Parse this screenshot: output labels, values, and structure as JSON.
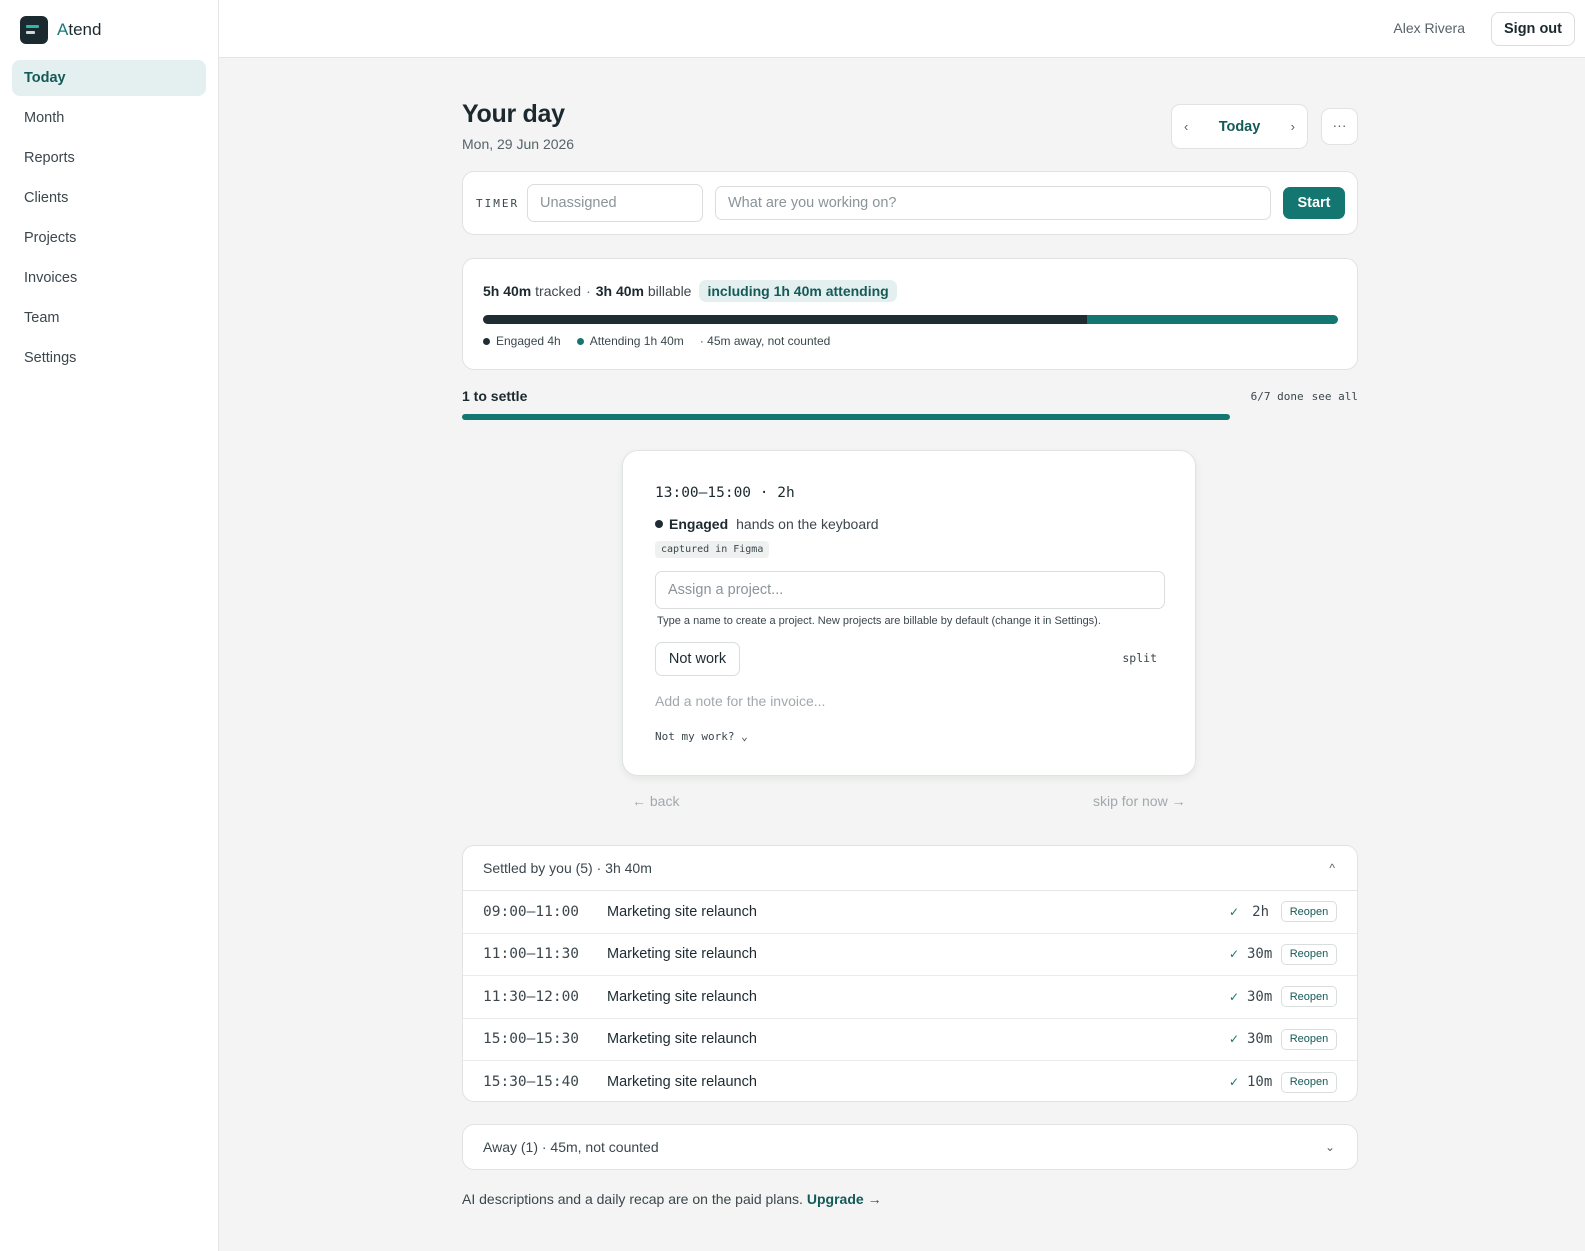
{
  "app": {
    "brand_prefix": "A",
    "brand_rest": "tend"
  },
  "nav": {
    "items": [
      {
        "label": "Today",
        "active": true
      },
      {
        "label": "Month"
      },
      {
        "label": "Reports"
      },
      {
        "label": "Clients"
      },
      {
        "label": "Projects"
      },
      {
        "label": "Invoices"
      },
      {
        "label": "Team"
      },
      {
        "label": "Settings"
      }
    ]
  },
  "topbar": {
    "user_name": "Alex Rivera",
    "signout_label": "Sign out"
  },
  "header": {
    "title": "Your day",
    "date": "Mon, 29 Jun 2026",
    "prev_glyph": "‹",
    "today_label": "Today",
    "next_glyph": "›",
    "more_glyph": "···"
  },
  "timer": {
    "label": "TIMER",
    "project_placeholder": "Unassigned",
    "task_placeholder": "What are you working on?",
    "start_label": "Start"
  },
  "summary": {
    "tracked_value": "5h 40m",
    "tracked_label": "tracked",
    "billable_value": "3h 40m",
    "billable_label": "billable",
    "attending_pill": "including 1h 40m attending",
    "engaged_fraction": 0.706,
    "attending_fraction": 0.294,
    "legend_engaged": "Engaged 4h",
    "legend_attending": "Attending 1h 40m",
    "legend_away": "· 45m away, not counted"
  },
  "settle": {
    "title": "1 to settle",
    "done": "6/7 done",
    "see_all": "see all",
    "progress_fraction": 0.857
  },
  "review": {
    "time_range": "13:00–15:00 · 2h",
    "state": "Engaged",
    "state_desc": "hands on the keyboard",
    "captured_tag": "captured in Figma",
    "assign_placeholder": "Assign a project...",
    "help_text": "Type a name to create a project. New projects are billable by default (change it in Settings).",
    "not_work_label": "Not work",
    "split_label": "split",
    "note_placeholder": "Add a note for the invoice...",
    "not_mine_label": "Not my work? ⌄",
    "back_label": "← back",
    "skip_label": "skip for now →"
  },
  "settled": {
    "header": "Settled by you (5) · 3h 40m",
    "caret": "^",
    "check": "✓",
    "reopen_label": "Reopen",
    "rows": [
      {
        "time": "09:00–11:00",
        "project": "Marketing site relaunch",
        "duration": "2h"
      },
      {
        "time": "11:00–11:30",
        "project": "Marketing site relaunch",
        "duration": "30m"
      },
      {
        "time": "11:30–12:00",
        "project": "Marketing site relaunch",
        "duration": "30m"
      },
      {
        "time": "15:00–15:30",
        "project": "Marketing site relaunch",
        "duration": "30m"
      },
      {
        "time": "15:30–15:40",
        "project": "Marketing site relaunch",
        "duration": "10m"
      }
    ]
  },
  "away": {
    "header": "Away (1) · 45m, not counted",
    "caret": "⌄"
  },
  "footer": {
    "note": "AI descriptions and a daily recap are on the paid plans.",
    "upgrade": "Upgrade →"
  },
  "colors": {
    "accent": "#147670",
    "engaged": "#1f2d33",
    "pill_bg": "#e4f0ef"
  }
}
